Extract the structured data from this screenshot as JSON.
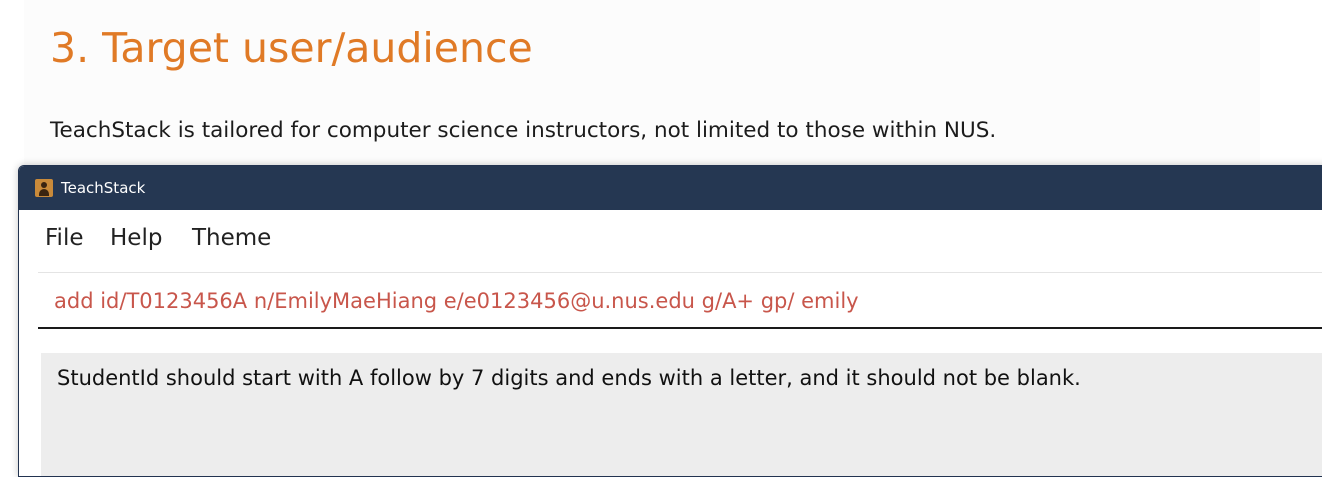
{
  "document": {
    "heading": "3. Target user/audience",
    "paragraph": "TeachStack is tailored for computer science instructors, not limited to those within NUS."
  },
  "window": {
    "title": "TeachStack",
    "icon": "address-book-icon"
  },
  "menu": {
    "items": [
      {
        "label": "File"
      },
      {
        "label": "Help"
      },
      {
        "label": "Theme"
      }
    ]
  },
  "command_box": {
    "value": "add id/T0123456A n/EmilyMaeHiang e/e0123456@u.nus.edu g/A+ gp/ emily"
  },
  "result_display": {
    "message": "StudentId should start with A follow by 7 digits and ends with a letter, and it should not be blank."
  },
  "colors": {
    "heading": "#e07a26",
    "title_bar": "#253752",
    "command_text_error": "#c8564b",
    "result_background": "#ededed"
  }
}
